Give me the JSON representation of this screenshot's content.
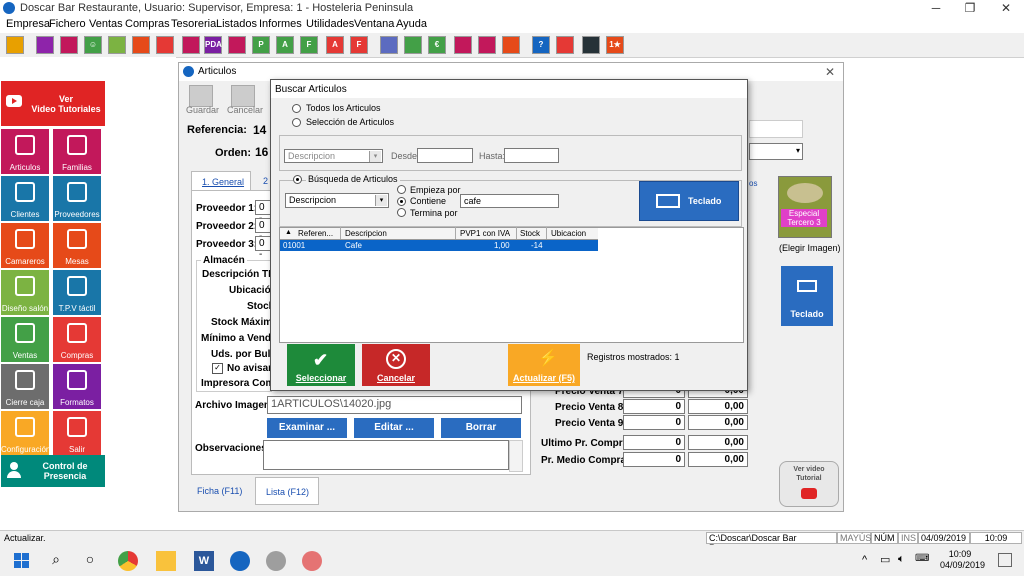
{
  "window": {
    "title": "Doscar Bar Restaurante, Usuario: Supervisor, Empresa: 1 - Hosteleria Peninsula",
    "minimize": "─",
    "maximize": "❐",
    "close": "✕"
  },
  "menu": [
    "Empresa",
    "Fichero",
    "Ventas",
    "Compras",
    "Tesoreria",
    "Listados",
    "Informes",
    "Utilidades",
    "Ventana",
    "Ayuda"
  ],
  "toolbar_icons": [
    {
      "name": "edit-icon",
      "text": "",
      "color": "#e8a000"
    },
    {
      "name": "group-icon",
      "text": "",
      "color": "#8e24aa"
    },
    {
      "name": "tree-icon",
      "text": "",
      "color": "#c2185b"
    },
    {
      "name": "smiley-icon",
      "text": "☺",
      "color": "#43a047"
    },
    {
      "name": "box-icon",
      "text": "",
      "color": "#7cb342"
    },
    {
      "name": "people-icon",
      "text": "",
      "color": "#e64a19"
    },
    {
      "name": "tables-icon",
      "text": "",
      "color": "#e53935"
    },
    {
      "name": "layout-icon",
      "text": "",
      "color": "#c2185b"
    },
    {
      "name": "pda-icon",
      "text": "PDA",
      "color": "#7b1fa2"
    },
    {
      "name": "pie-icon",
      "text": "",
      "color": "#c2185b"
    },
    {
      "name": "p-icon",
      "text": "P",
      "color": "#43a047"
    },
    {
      "name": "a-icon",
      "text": "A",
      "color": "#43a047"
    },
    {
      "name": "f-icon",
      "text": "F",
      "color": "#43a047"
    },
    {
      "name": "a-red-icon",
      "text": "A",
      "color": "#e53935"
    },
    {
      "name": "f-red-icon",
      "text": "F",
      "color": "#e53935"
    },
    {
      "name": "gear-icon",
      "text": "",
      "color": "#5c6bc0"
    },
    {
      "name": "doc-icon",
      "text": "",
      "color": "#43a047"
    },
    {
      "name": "euro-icon",
      "text": "€",
      "color": "#43a047"
    },
    {
      "name": "phone-icon",
      "text": "",
      "color": "#c2185b"
    },
    {
      "name": "flow-icon",
      "text": "",
      "color": "#c2185b"
    },
    {
      "name": "calc-icon",
      "text": "",
      "color": "#e64a19"
    },
    {
      "name": "help-icon",
      "text": "?",
      "color": "#1565c0"
    },
    {
      "name": "exit-icon",
      "text": "",
      "color": "#e53935"
    },
    {
      "name": "tools-icon",
      "text": "",
      "color": "#263238"
    },
    {
      "name": "one-star-icon",
      "text": "1★",
      "color": "#e64a19"
    }
  ],
  "left_panel": {
    "video": {
      "line1": "Ver",
      "line2": "Video Tutoriales"
    },
    "buttons": [
      {
        "label": "Articulos",
        "icon": "people-icon",
        "color": "#c2185b"
      },
      {
        "label": "Familias",
        "icon": "tree-icon",
        "color": "#c2185b"
      },
      {
        "label": "Clientes",
        "icon": "clients-icon",
        "color": "#1976a8"
      },
      {
        "label": "Proveedores",
        "icon": "box-icon",
        "color": "#1976a8"
      },
      {
        "label": "Camareros",
        "icon": "waiters-icon",
        "color": "#e64a19"
      },
      {
        "label": "Mesas",
        "icon": "tables-icon",
        "color": "#e64a19"
      },
      {
        "label": "Diseño salón",
        "icon": "design-icon",
        "color": "#7cb342"
      },
      {
        "label": "T.P.V táctil",
        "icon": "monitor-icon",
        "color": "#1976a8"
      },
      {
        "label": "Ventas",
        "icon": "f-icon",
        "color": "#43a047"
      },
      {
        "label": "Compras",
        "icon": "euro-icon",
        "color": "#e53935"
      },
      {
        "label": "Cierre caja",
        "icon": "safe-icon",
        "color": "#6d6d6d"
      },
      {
        "label": "Formatos",
        "icon": "d-icon",
        "color": "#7b1fa2"
      },
      {
        "label": "Configuración",
        "icon": "gear-icon",
        "color": "#f9a825"
      },
      {
        "label": "Salir",
        "icon": "exit-icon",
        "color": "#e53935"
      }
    ],
    "presence": {
      "line1": "Control de",
      "line2": "Presencia"
    }
  },
  "articulos_window": {
    "title": "Articulos",
    "close": "✕",
    "guardar": "Guardar",
    "cancelar": "Cancelar",
    "referencia_label": "Referencia:",
    "referencia_value": "14",
    "orden_label": "Orden:",
    "orden_value": "16",
    "tab1": "1. General",
    "tab2": "2",
    "proveedores": [
      {
        "label": "Proveedor 1:",
        "value": "0 -"
      },
      {
        "label": "Proveedor 2:",
        "value": "0 -"
      },
      {
        "label": "Proveedor 3:",
        "value": "0 -"
      }
    ],
    "almacen": "Almacén",
    "almacen_labels": [
      "Descripción TPV",
      "Ubicación",
      "Stock",
      "Stock Máximo",
      "Mínimo a Vender",
      "Uds. por Bulto"
    ],
    "no_avisar": "No avisar",
    "impresora": "Impresora Comandas",
    "archivo_label": "Archivo Imagen:",
    "archivo_value": "1ARTICULOS\\14020.jpg",
    "examinar": "Examinar ...",
    "editar": "Editar ...",
    "borrar": "Borrar",
    "observaciones": "Observaciones:",
    "precios": [
      {
        "label": "Precio Venta 7:",
        "v1": "0",
        "v2": "0,00"
      },
      {
        "label": "Precio Venta 8:",
        "v1": "0",
        "v2": "0,00"
      },
      {
        "label": "Precio Venta 9:",
        "v1": "0",
        "v2": "0,00"
      },
      {
        "label": "Ultimo Pr. Compra:",
        "v1": "0",
        "v2": "0,00"
      },
      {
        "label": "Pr. Medio Compra:",
        "v1": "0",
        "v2": "0,00"
      }
    ],
    "especial": "Especial Tercero 3",
    "elegir_imagen": "(Elegir Imagen)",
    "teclado": "Teclado",
    "ver_video": "Ver video",
    "tutorial": "Tutorial",
    "ficha_tab": "Ficha (F11)",
    "lista_tab": "Lista (F12)",
    "tabs_os": "os"
  },
  "modal": {
    "title": "Buscar Articulos",
    "radio_todos": "Todos los Articulos",
    "radio_seleccion": "Selección de Articulos",
    "combo_descripcion": "Descripcion",
    "desde": "Desde:",
    "hasta": "Hasta:",
    "busqueda": "Búsqueda de Articulos",
    "search_combo": "Descripcion",
    "empieza": "Empieza por",
    "contiene": "Contiene",
    "termina": "Termina por",
    "search_value": "cafe",
    "teclado": "Teclado",
    "table_headers": [
      "Referen...",
      "Descripcion",
      "PVP1 con IVA",
      "Stock",
      "Ubicacion"
    ],
    "rows": [
      {
        "ref": "01001",
        "desc": "Cafe",
        "pvp": "1,00",
        "stock": "-14",
        "ubic": ""
      }
    ],
    "seleccionar": "Seleccionar",
    "cancelar": "Cancelar",
    "actualizar": "Actualizar (F5)",
    "registros": "Registros mostrados: 1"
  },
  "statusbar": {
    "left": "Actualizar.",
    "path": "C:\\Doscar\\Doscar Bar Restaurante",
    "mayus": "MAYÚS",
    "num": "NÚM",
    "ins": "INS",
    "date": "04/09/2019",
    "time": "10:09"
  },
  "taskbar": {
    "time": "10:09",
    "date": "04/09/2019"
  },
  "colors": {
    "selection": "#0a64c8",
    "green_btn": "#1e8a3a",
    "red_btn": "#c62828",
    "orange_btn": "#f9a825",
    "blue_btn": "#2a6cc0"
  }
}
